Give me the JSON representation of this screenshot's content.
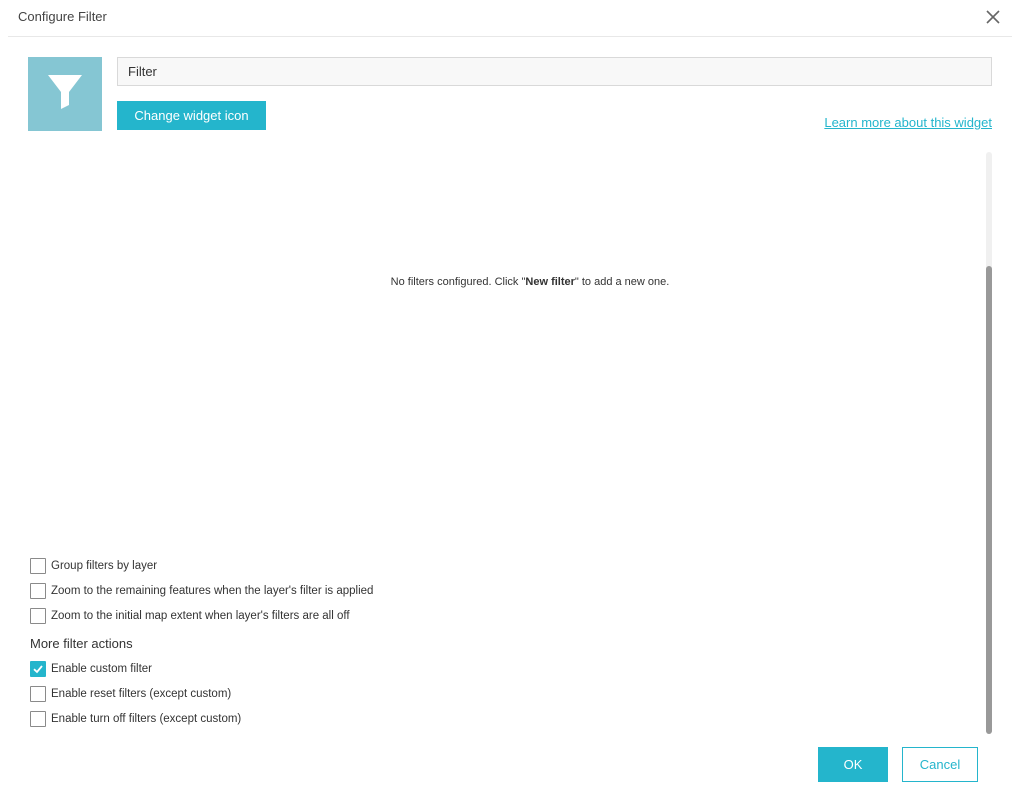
{
  "dialog": {
    "title": "Configure Filter",
    "close_icon": "close-icon"
  },
  "widget": {
    "icon": "filter-funnel-icon",
    "icon_bg_color": "#85c6d3",
    "name_value": "Filter",
    "change_icon_label": "Change widget icon",
    "learn_more_label": "Learn more about this widget"
  },
  "filters": {
    "empty_prefix": "No filters configured. Click \"",
    "empty_emph": "New filter",
    "empty_suffix": "\" to add a new one."
  },
  "options": [
    {
      "label": "Group filters by layer",
      "checked": false
    },
    {
      "label": "Zoom to the remaining features when the layer's filter is applied",
      "checked": false
    },
    {
      "label": "Zoom to the initial map extent when layer's filters are all off",
      "checked": false
    }
  ],
  "more_actions": {
    "title": "More filter actions",
    "items": [
      {
        "label": "Enable custom filter",
        "checked": true
      },
      {
        "label": "Enable reset filters (except custom)",
        "checked": false
      },
      {
        "label": "Enable turn off filters (except custom)",
        "checked": false
      }
    ]
  },
  "footer": {
    "ok_label": "OK",
    "cancel_label": "Cancel"
  },
  "colors": {
    "accent": "#24b5cc"
  }
}
